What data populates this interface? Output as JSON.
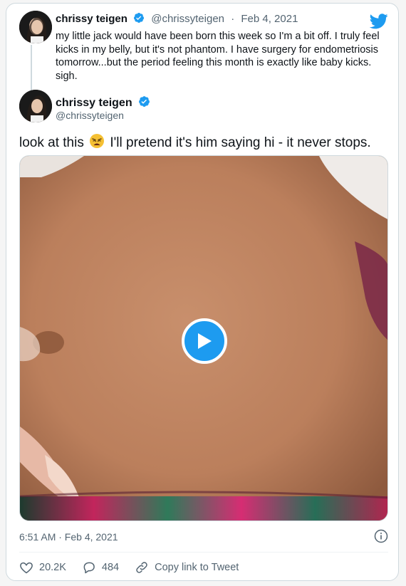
{
  "quoted": {
    "name": "chrissy teigen",
    "handle": "@chrissyteigen",
    "sep": "·",
    "date": "Feb 4, 2021",
    "text": "my little jack would have been born this week so I'm a bit off. I truly feel kicks in my belly, but it's not phantom. I have surgery for endometriosis tomorrow...but the period feeling this month is exactly like baby kicks. sigh."
  },
  "tweet": {
    "name": "chrissy teigen",
    "handle": "@chrissyteigen",
    "text_before": "look at this",
    "text_after": "I'll pretend it's him saying hi - it never stops.",
    "emoji": "weary-face-emoji",
    "timestamp": "6:51 AM · Feb 4, 2021"
  },
  "actions": {
    "likes": "20.2K",
    "replies": "484",
    "copy_link": "Copy link to Tweet"
  },
  "icons": {
    "logo": "twitter-bird-icon",
    "verified": "verified-badge-icon",
    "play": "play-icon",
    "info": "info-icon",
    "like": "heart-icon",
    "reply": "reply-icon",
    "link": "link-icon"
  },
  "colors": {
    "accent": "#1d9bf0",
    "text": "#0f1419",
    "muted": "#536471",
    "border": "#cfd9de"
  }
}
